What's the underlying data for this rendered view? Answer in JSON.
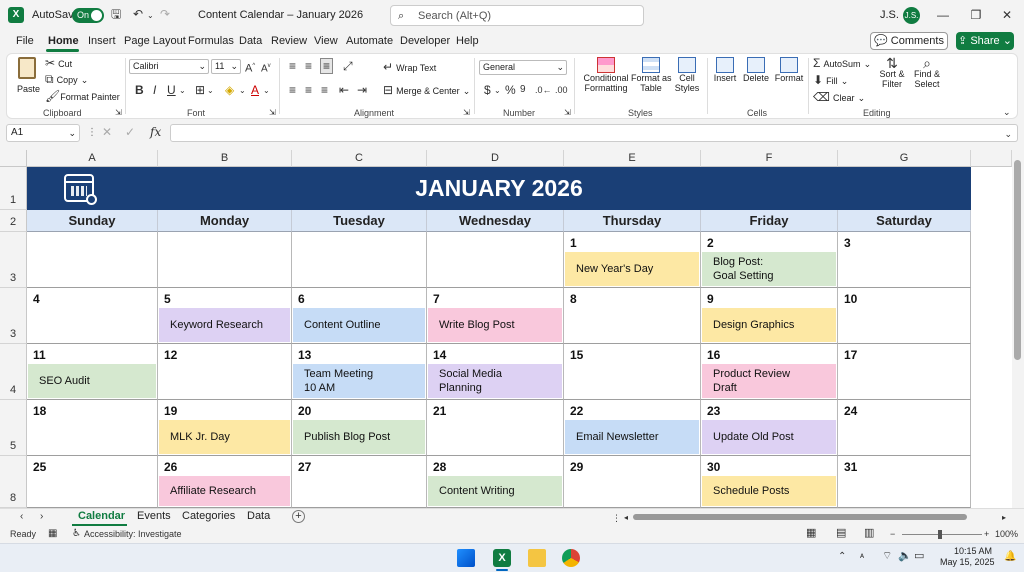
{
  "titlebar": {
    "autosave": "AutoSave",
    "toggle": "On",
    "doc_title": "Content Calendar – January 2026",
    "search_placeholder": "Search (Alt+Q)",
    "user": "J.S.",
    "avatar": "J.S."
  },
  "tabs": [
    "File",
    "Home",
    "Insert",
    "Page Layout",
    "Formulas",
    "Data",
    "Review",
    "View",
    "Automate",
    "Developer",
    "Help"
  ],
  "actions": {
    "comments": "Comments",
    "share": "Share"
  },
  "ribbon": {
    "clipboard": {
      "label": "Clipboard",
      "paste": "Paste",
      "cut": "Cut",
      "copy": "Copy",
      "format_painter": "Format Painter"
    },
    "font": {
      "label": "Font",
      "name": "Calibri",
      "size": "11"
    },
    "alignment": {
      "label": "Alignment",
      "wrap": "Wrap Text",
      "merge": "Merge & Center"
    },
    "number": {
      "label": "Number",
      "format": "General"
    },
    "styles": {
      "label": "Styles",
      "cond1": "Conditional",
      "cond2": "Formatting",
      "table1": "Format as",
      "table2": "Table",
      "cell1": "Cell",
      "cell2": "Styles"
    },
    "cells": {
      "label": "Cells",
      "insert": "Insert",
      "delete": "Delete",
      "format": "Format"
    },
    "editing": {
      "label": "Editing",
      "autosum": "AutoSum",
      "fill": "Fill",
      "clear": "Clear",
      "sort1": "Sort &",
      "sort2": "Filter",
      "find1": "Find &",
      "find2": "Select"
    }
  },
  "formula": {
    "namebox": "A1",
    "fx": "fx"
  },
  "columns": [
    "A",
    "B",
    "C",
    "D",
    "E",
    "F",
    "G"
  ],
  "rows": [
    "1",
    "2",
    "3",
    "3",
    "4",
    "5",
    "8"
  ],
  "calendar": {
    "title": "JANUARY 2026",
    "days": [
      "Sunday",
      "Monday",
      "Tuesday",
      "Wednesday",
      "Thursday",
      "Friday",
      "Saturday"
    ],
    "weeks": [
      [
        {
          "n": "",
          "e": ""
        },
        {
          "n": "",
          "e": ""
        },
        {
          "n": "",
          "e": ""
        },
        {
          "n": "",
          "e": ""
        },
        {
          "n": "1",
          "e": "New Year's Day",
          "c": "yellow"
        },
        {
          "n": "2",
          "e": "Blog Post:\nGoal Setting",
          "c": "green"
        },
        {
          "n": "3",
          "e": ""
        }
      ],
      [
        {
          "n": "4",
          "e": ""
        },
        {
          "n": "5",
          "e": "Keyword Research",
          "c": "purple"
        },
        {
          "n": "6",
          "e": "Content Outline",
          "c": "blue"
        },
        {
          "n": "7",
          "e": "Write Blog Post",
          "c": "pink"
        },
        {
          "n": "8",
          "e": ""
        },
        {
          "n": "9",
          "e": "Design Graphics",
          "c": "yellow"
        },
        {
          "n": "10",
          "e": ""
        }
      ],
      [
        {
          "n": "11",
          "e": "SEO Audit",
          "c": "green"
        },
        {
          "n": "12",
          "e": ""
        },
        {
          "n": "13",
          "e": "Team Meeting\n10 AM",
          "c": "blue"
        },
        {
          "n": "14",
          "e": "Social Media\nPlanning",
          "c": "purple"
        },
        {
          "n": "15",
          "e": ""
        },
        {
          "n": "16",
          "e": "Product Review\nDraft",
          "c": "pink"
        },
        {
          "n": "17",
          "e": ""
        }
      ],
      [
        {
          "n": "18",
          "e": ""
        },
        {
          "n": "19",
          "e": "MLK Jr. Day",
          "c": "yellow"
        },
        {
          "n": "20",
          "e": "Publish Blog Post",
          "c": "green"
        },
        {
          "n": "21",
          "e": ""
        },
        {
          "n": "22",
          "e": "Email Newsletter",
          "c": "blue"
        },
        {
          "n": "23",
          "e": "Update Old Post",
          "c": "purple"
        },
        {
          "n": "24",
          "e": ""
        }
      ],
      [
        {
          "n": "25",
          "e": ""
        },
        {
          "n": "26",
          "e": "Affiliate Research",
          "c": "pink"
        },
        {
          "n": "27",
          "e": ""
        },
        {
          "n": "28",
          "e": "Content Writing",
          "c": "green"
        },
        {
          "n": "29",
          "e": ""
        },
        {
          "n": "30",
          "e": "Schedule Posts",
          "c": "yellow"
        },
        {
          "n": "31",
          "e": ""
        }
      ]
    ]
  },
  "sheets": [
    "Calendar",
    "Events",
    "Categories",
    "Data"
  ],
  "status": {
    "ready": "Ready",
    "accessibility": "Accessibility: Investigate",
    "zoom": "100%"
  },
  "taskbar": {
    "time": "10:15 AM",
    "date": "May 15, 2025"
  },
  "colors": {
    "accent": "#107c41",
    "banner": "#1a3f76",
    "yellow": "#fde8a4",
    "green": "#d5e8cf",
    "purple": "#ddd1f3",
    "blue": "#c6dcf6",
    "pink": "#f9c8dc"
  }
}
